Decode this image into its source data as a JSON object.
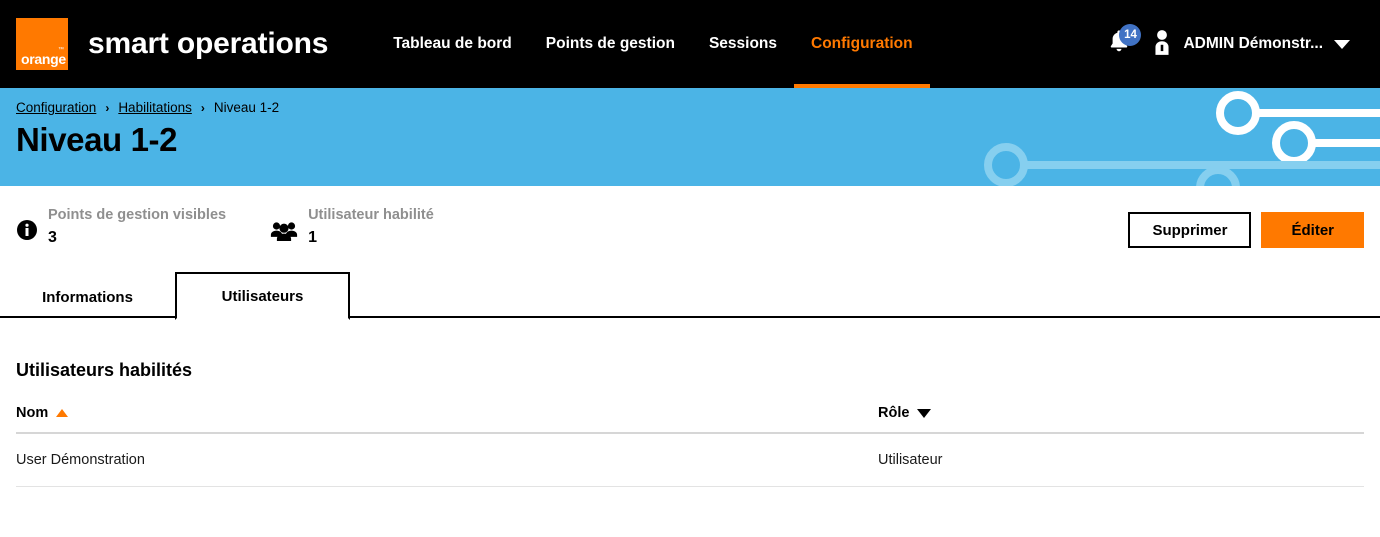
{
  "header": {
    "logo_word": "orange",
    "logo_tm": "™",
    "app_title": "smart operations",
    "nav": [
      {
        "label": "Tableau de bord",
        "active": false
      },
      {
        "label": "Points de gestion",
        "active": false
      },
      {
        "label": "Sessions",
        "active": false
      },
      {
        "label": "Configuration",
        "active": true
      }
    ],
    "notifications": {
      "icon": "bell-icon",
      "count": "14",
      "badge_color": "#4072C4"
    },
    "user": {
      "icon": "user-avatar-icon",
      "name": "ADMIN Démonstr...",
      "caret": "chevron-down-icon"
    }
  },
  "banner": {
    "background_color": "#4BB4E6",
    "breadcrumb": [
      {
        "label": "Configuration",
        "link": true
      },
      {
        "label": "Habilitations",
        "link": true
      },
      {
        "label": "Niveau 1-2",
        "link": false
      }
    ],
    "separator": "›",
    "title": "Niveau 1-2"
  },
  "summary": {
    "stats": [
      {
        "icon": "info-circle-icon",
        "label": "Points de gestion visibles",
        "value": "3"
      },
      {
        "icon": "users-group-icon",
        "label": "Utilisateur habilité",
        "value": "1"
      }
    ],
    "actions": {
      "delete_label": "Supprimer",
      "edit_label": "Éditer",
      "edit_color": "#FF7900"
    }
  },
  "tabs": [
    {
      "label": "Informations",
      "active": false
    },
    {
      "label": "Utilisateurs",
      "active": true
    }
  ],
  "content": {
    "section_title": "Utilisateurs habilités",
    "table": {
      "columns": [
        {
          "label": "Nom",
          "sort": "asc",
          "sort_color": "#FF7900"
        },
        {
          "label": "Rôle",
          "sort": "desc",
          "sort_color": "#000000"
        }
      ],
      "rows": [
        {
          "nom": "User Démonstration",
          "role": "Utilisateur"
        }
      ]
    }
  },
  "theme": {
    "orange": "#FF7900",
    "blue": "#4BB4E6",
    "black": "#000000",
    "badge_blue": "#4072C4"
  }
}
